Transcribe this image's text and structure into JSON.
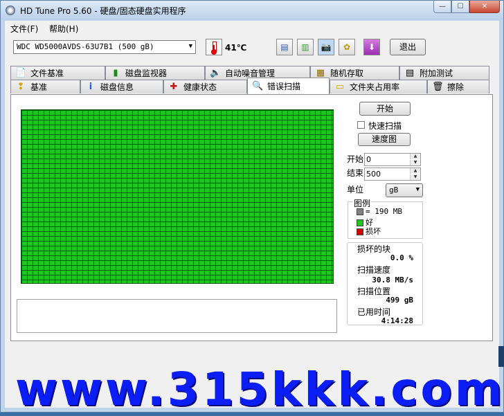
{
  "window": {
    "title": "HD Tune Pro 5.60 - 硬盘/固态硬盘实用程序"
  },
  "window_controls": {
    "minimize": "—",
    "maximize": "☐",
    "close": "✕"
  },
  "menu": {
    "file": "文件(F)",
    "help": "帮助(H)"
  },
  "toolbar": {
    "drive": "WDC WD5000AVDS-63U7B1 (500 gB)",
    "temperature": "41℃",
    "exit_label": "退出",
    "icons": [
      "copy-info-icon",
      "copy-screenshot-icon",
      "camera-icon",
      "options-icon",
      "save-icon"
    ]
  },
  "tabs_top": [
    {
      "label": "文件基准",
      "icon": "file-icon"
    },
    {
      "label": "磁盘监视器",
      "icon": "chart-icon"
    },
    {
      "label": "自动噪音管理",
      "icon": "speaker-icon"
    },
    {
      "label": "随机存取",
      "icon": "random-icon"
    },
    {
      "label": "附加测试",
      "icon": "extra-icon"
    }
  ],
  "tabs_bottom": [
    {
      "label": "基准",
      "icon": "benchmark-icon"
    },
    {
      "label": "磁盘信息",
      "icon": "info-icon"
    },
    {
      "label": "健康状态",
      "icon": "health-icon"
    },
    {
      "label": "错误扫描",
      "icon": "magnifier-icon",
      "active": true
    },
    {
      "label": "文件夹占用率",
      "icon": "folder-icon"
    },
    {
      "label": "擦除",
      "icon": "trash-icon"
    }
  ],
  "scan": {
    "start_button": "开始",
    "quick_scan_label": "快速扫描",
    "quick_scan_checked": false,
    "speed_map_button": "速度图",
    "start_label": "开始",
    "start_value": "0",
    "end_label": "结束",
    "end_value": "500",
    "unit_label": "单位",
    "unit_value": "gB",
    "legend_title": "图例",
    "legend": [
      {
        "text": "= 190 MB",
        "color": "#808080"
      },
      {
        "text": "好",
        "color": "#1ec81e"
      },
      {
        "text": "损坏",
        "color": "#d00000"
      }
    ],
    "grid_color_ok": "#1ec81e",
    "stats": {
      "damaged_label": "损坏的块",
      "damaged_value": "0.0 %",
      "speed_label": "扫描速度",
      "speed_value": "30.8 MB/s",
      "position_label": "扫描位置",
      "position_value": "499 gB",
      "elapsed_label": "已用时间",
      "elapsed_value": "4:14:28"
    }
  },
  "watermark": "www.315kkk.com"
}
